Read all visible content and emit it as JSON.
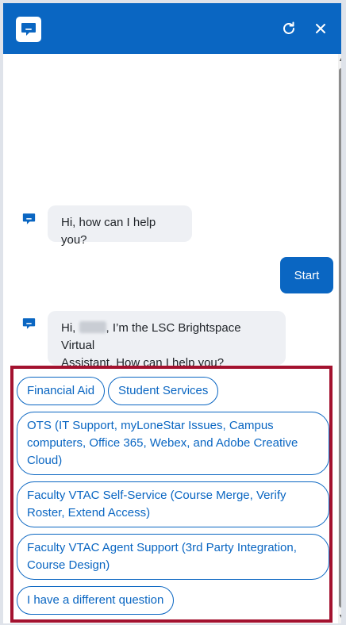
{
  "header": {
    "logo_icon": "chat-bubble-icon",
    "refresh_icon": "refresh-icon",
    "close_icon": "close-icon",
    "bg_color": "#0a66c2"
  },
  "messages": {
    "bot_greeting": "Hi, how can I help you?",
    "user_start": "Start",
    "bot_intro_prefix": "Hi, ",
    "bot_intro_suffix_line1": ", I’m the LSC Brightspace Virtual",
    "bot_intro_line2": "Assistant. How can I help you?"
  },
  "options": [
    "Financial Aid",
    "Student Services",
    "OTS (IT Support, myLoneStar Issues, Campus computers, Office 365, Webex, and Adobe Creative Cloud)",
    "Faculty VTAC Self-Service (Course Merge, Verify Roster, Extend Access)",
    "Faculty VTAC Agent Support (3rd Party Integration, Course Design)",
    "I have a different question"
  ],
  "options_lines": {
    "ots": [
      "OTS (IT Support, myLoneStar Issues, Campus",
      "computers, Office 365, Webex, and Adobe Creative",
      "Cloud)"
    ],
    "vtac_self": [
      "Faculty VTAC Self-Service (Course Merge, Verify",
      "Roster, Extend Access)"
    ],
    "vtac_agent": [
      "Faculty VTAC Agent Support (3rd Party Integration,",
      "Course Design)"
    ]
  },
  "colors": {
    "accent": "#0a66c2",
    "highlight_border": "#a3122f",
    "bubble_bg": "#eef0f4"
  }
}
